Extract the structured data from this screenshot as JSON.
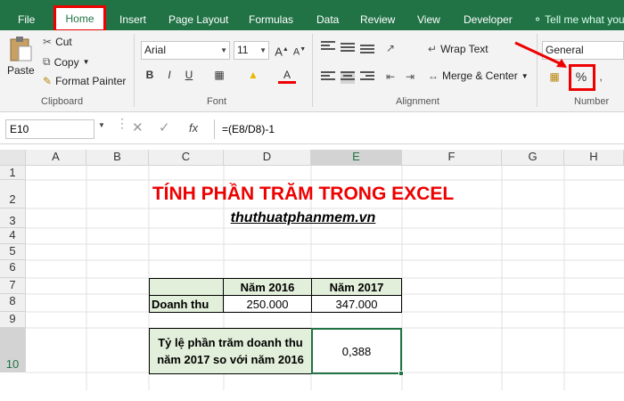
{
  "tabs": [
    "File",
    "Home",
    "Insert",
    "Page Layout",
    "Formulas",
    "Data",
    "Review",
    "View",
    "Developer",
    "Tell me what you"
  ],
  "clipboard": {
    "paste": "Paste",
    "cut": "Cut",
    "copy": "Copy",
    "format_painter": "Format Painter",
    "label": "Clipboard"
  },
  "font": {
    "name": "Arial",
    "size": "11",
    "label": "Font"
  },
  "alignment": {
    "wrap": "Wrap Text",
    "merge": "Merge & Center",
    "label": "Alignment"
  },
  "number": {
    "format": "General",
    "percent": "%",
    "label": "Number"
  },
  "formula_bar": {
    "name_box": "E10",
    "fx": "fx",
    "formula": "=(E8/D8)-1"
  },
  "columns": [
    "A",
    "B",
    "C",
    "D",
    "E",
    "F",
    "G",
    "H"
  ],
  "rows": [
    "1",
    "2",
    "3",
    "4",
    "5",
    "6",
    "7",
    "8",
    "9",
    "10"
  ],
  "sheet": {
    "title": "TÍNH PHẦN TRĂM TRONG EXCEL",
    "subtitle": "thuthuatphanmem.vn",
    "h2016": "Năm 2016",
    "h2017": "Năm 2017",
    "revenue_label": "Doanh thu",
    "d8": "250.000",
    "e8": "347.000",
    "ratio_label": "Tỷ lệ phần trăm doanh thu năm 2017 so với năm 2016",
    "e10": "0,388"
  },
  "colors": {
    "excel_green": "#217346",
    "annot_red": "#e00000",
    "header_fill": "#e2efda"
  }
}
